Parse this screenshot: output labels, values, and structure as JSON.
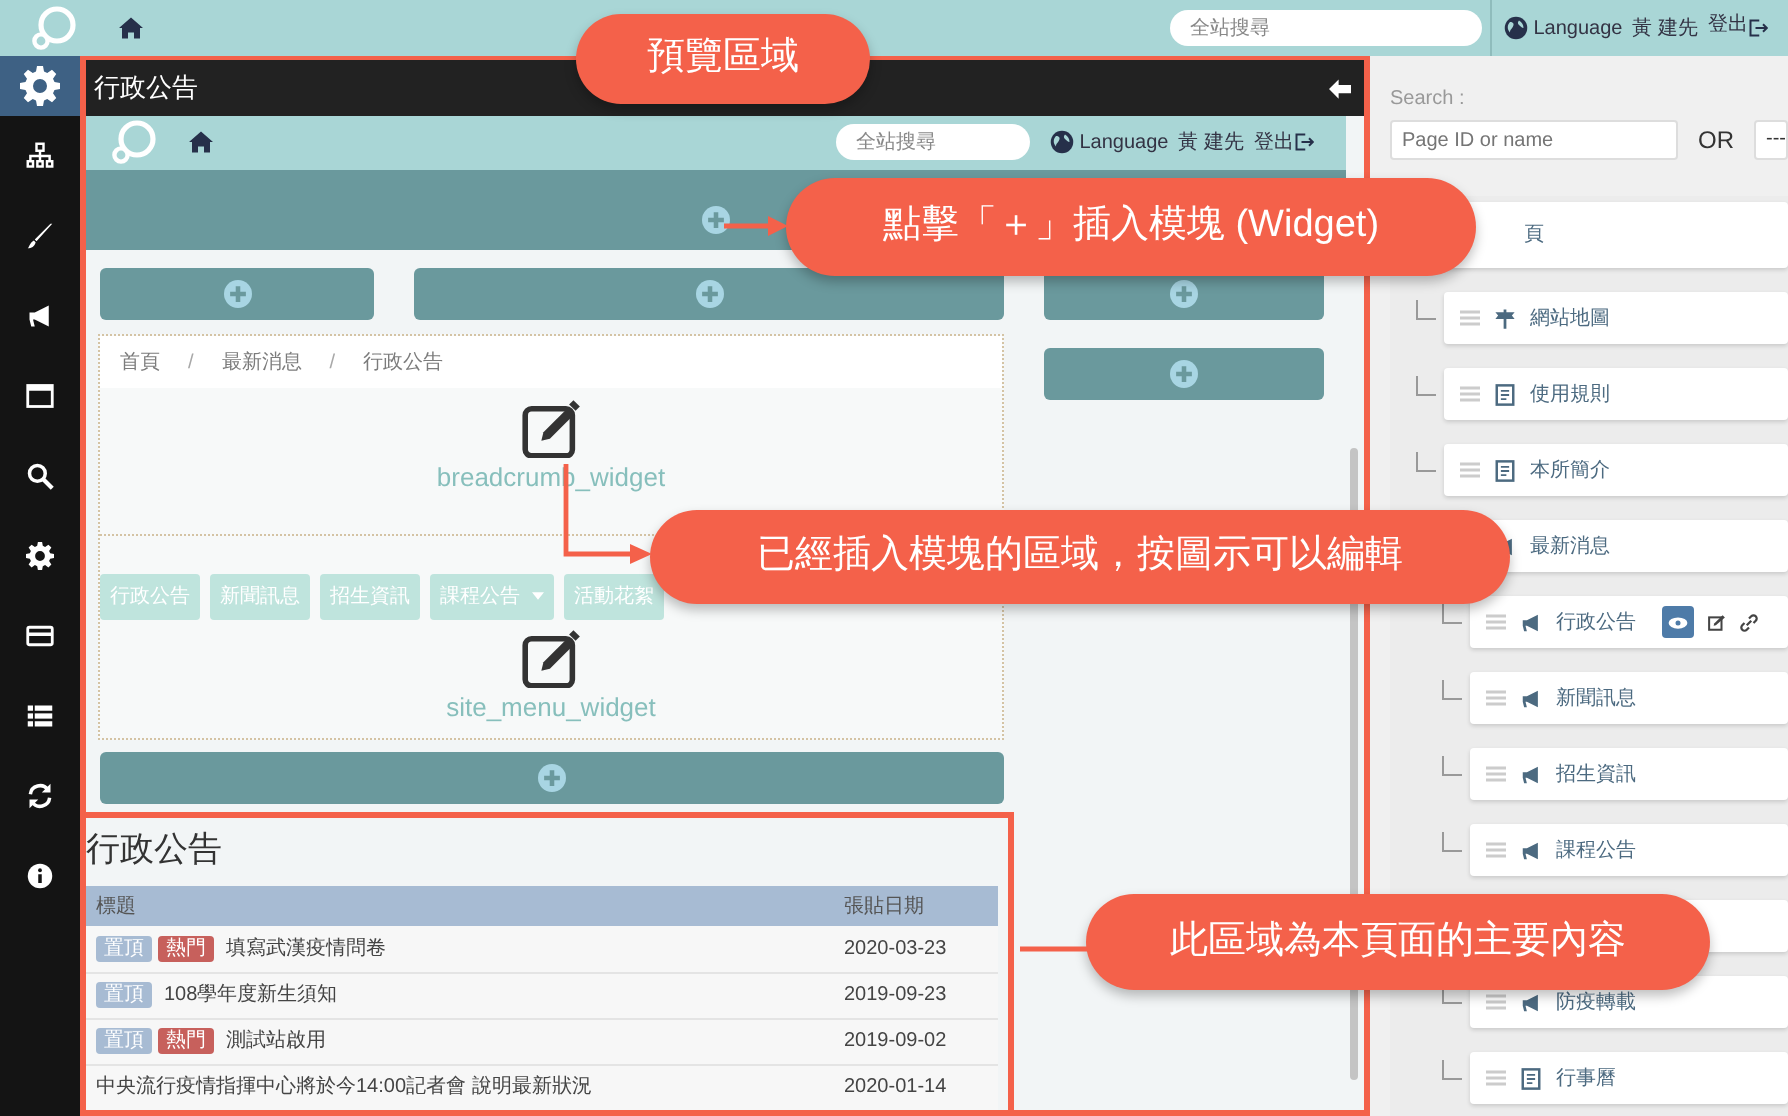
{
  "top_bar": {
    "search_placeholder": "全站搜尋",
    "language": "Language",
    "user": "黃 建先",
    "logout": "登出"
  },
  "sidebar": {
    "items": [
      {
        "kind": "gear",
        "selected": true
      },
      {
        "kind": "sitemap",
        "selected": false
      },
      {
        "kind": "brush",
        "selected": false
      },
      {
        "kind": "megaphone",
        "selected": false
      },
      {
        "kind": "window",
        "selected": false
      },
      {
        "kind": "search",
        "selected": false
      },
      {
        "kind": "gear",
        "selected": false
      },
      {
        "kind": "card",
        "selected": false
      },
      {
        "kind": "list",
        "selected": false
      },
      {
        "kind": "refresh",
        "selected": false
      },
      {
        "kind": "info",
        "selected": false
      }
    ]
  },
  "preview": {
    "title": "行政公告",
    "site_header": {
      "search_placeholder": "全站搜尋",
      "language": "Language",
      "user": "黃 建先",
      "logout": "登出"
    },
    "breadcrumb": [
      {
        "text": "首頁",
        "kind": "link"
      },
      {
        "text": "/",
        "kind": "separator"
      },
      {
        "text": "最新消息",
        "kind": "link"
      },
      {
        "text": "/",
        "kind": "separator"
      },
      {
        "text": "行政公告",
        "kind": "link"
      }
    ],
    "breadcrumb_widget": "breadcrumb_widget",
    "menu": [
      {
        "label": "行政公告",
        "dropdown": false
      },
      {
        "label": "新聞訊息",
        "dropdown": false
      },
      {
        "label": "招生資訊",
        "dropdown": false
      },
      {
        "label": "課程公告",
        "dropdown": true
      },
      {
        "label": "活動花絮",
        "dropdown": false
      }
    ],
    "menu_widget": "site_menu_widget",
    "announcements": {
      "title": "行政公告",
      "columns": [
        "標題",
        "張貼日期"
      ],
      "rows": [
        {
          "tags": [
            {
              "text": "置頂",
              "kind": "pinned"
            },
            {
              "text": "熱門",
              "kind": "hot"
            }
          ],
          "title": "填寫武漢疫情問卷",
          "date": "2020-03-23"
        },
        {
          "tags": [
            {
              "text": "置頂",
              "kind": "pinned"
            }
          ],
          "title": "108學年度新生須知",
          "date": "2019-09-23"
        },
        {
          "tags": [
            {
              "text": "置頂",
              "kind": "pinned"
            },
            {
              "text": "熱門",
              "kind": "hot"
            }
          ],
          "title": "測試站啟用",
          "date": "2019-09-02"
        },
        {
          "tags": [],
          "title": "中央流行疫情指揮中心將於今14:00記者會 說明最新狀況",
          "date": "2020-01-14"
        }
      ]
    }
  },
  "page_tree": {
    "search_label": "Search :",
    "search_placeholder": "Page ID or name",
    "or": "OR",
    "select_value": "---",
    "root": {
      "label": "頁",
      "selected": false,
      "children": [
        {
          "label": "網站地圖",
          "kind": "sign",
          "selected": false
        },
        {
          "label": "使用規則",
          "kind": "doc",
          "selected": false
        },
        {
          "label": "本所簡介",
          "kind": "doc",
          "selected": false
        },
        {
          "label": "最新消息",
          "kind": "megaphone",
          "selected": false,
          "children": [
            {
              "label": "行政公告",
              "kind": "megaphone",
              "selected": true
            },
            {
              "label": "新聞訊息",
              "kind": "megaphone",
              "selected": false
            },
            {
              "label": "招生資訊",
              "kind": "megaphone",
              "selected": false
            },
            {
              "label": "課程公告",
              "kind": "megaphone",
              "selected": false
            },
            {
              "kind": "covered"
            },
            {
              "label": "防疫轉載",
              "kind": "megaphone",
              "selected": false
            },
            {
              "label": "行事曆",
              "kind": "doc",
              "selected": false
            }
          ]
        }
      ]
    }
  },
  "callouts": [
    {
      "text": "預覽區域"
    },
    {
      "text": "點擊「＋」插入模塊 (Widget)"
    },
    {
      "text": "已經插入模塊的區域，按圖示可以編輯"
    },
    {
      "text": "此區域為本頁面的主要內容"
    }
  ]
}
